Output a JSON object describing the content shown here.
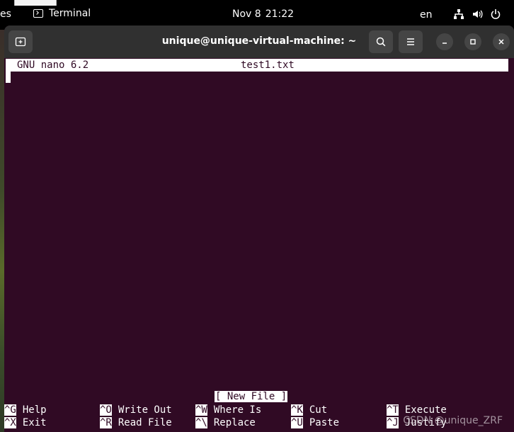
{
  "topbar": {
    "activities": "es",
    "app_name": "Terminal",
    "date": "Nov 8",
    "time": "21:22",
    "language": "en",
    "icons": [
      "network-icon",
      "volume-icon",
      "power-icon"
    ]
  },
  "window": {
    "title": "unique@unique-virtual-machine: ~",
    "buttons": [
      "new-tab",
      "search",
      "menu",
      "minimize",
      "maximize",
      "close"
    ]
  },
  "nano": {
    "version": "GNU nano 6.2",
    "filename": "test1.txt",
    "status": "[ New File ]",
    "shortcuts": [
      {
        "key": "^G",
        "label": "Help"
      },
      {
        "key": "^O",
        "label": "Write Out"
      },
      {
        "key": "^W",
        "label": "Where Is"
      },
      {
        "key": "^K",
        "label": "Cut"
      },
      {
        "key": "^T",
        "label": "Execute"
      },
      {
        "key": "^X",
        "label": "Exit"
      },
      {
        "key": "^R",
        "label": "Read File"
      },
      {
        "key": "^\\",
        "label": "Replace"
      },
      {
        "key": "^U",
        "label": "Paste"
      },
      {
        "key": "^J",
        "label": "Justify"
      }
    ]
  },
  "watermark": "CSDN @unique_ZRF",
  "colors": {
    "terminal_bg": "#300a24",
    "header_bg": "#303030",
    "topbar_bg": "#000000"
  }
}
